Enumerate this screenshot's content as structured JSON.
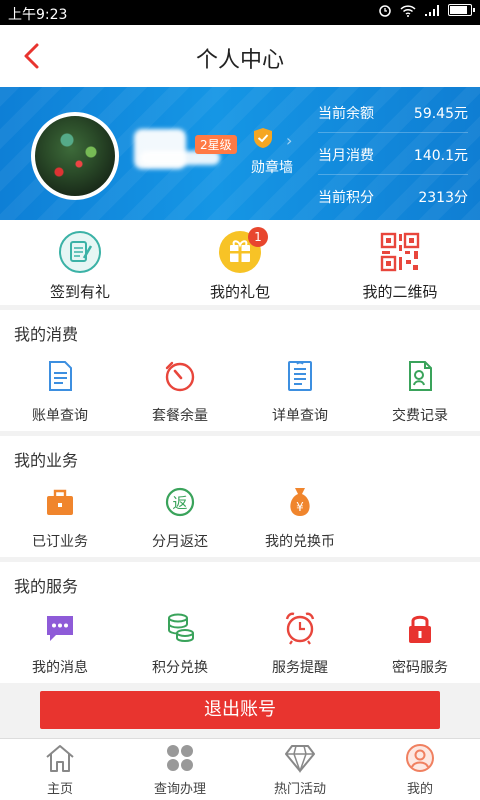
{
  "status_bar": {
    "time": "上午9:23"
  },
  "header": {
    "title": "个人中心"
  },
  "profile": {
    "level": "2星级",
    "medal_wall": "勋章墙",
    "account": [
      {
        "label": "当前余额",
        "value": "59.45元"
      },
      {
        "label": "当月消费",
        "value": "140.1元"
      },
      {
        "label": "当前积分",
        "value": "2313分"
      }
    ]
  },
  "quick_actions": [
    {
      "label": "签到有礼",
      "icon": "sign-in-icon"
    },
    {
      "label": "我的礼包",
      "icon": "gift-pack-icon",
      "badge": "1"
    },
    {
      "label": "我的二维码",
      "icon": "qr-code-icon"
    }
  ],
  "sections": [
    {
      "title": "我的消费",
      "items": [
        {
          "label": "账单查询",
          "icon": "bill-icon"
        },
        {
          "label": "套餐余量",
          "icon": "timer-icon"
        },
        {
          "label": "详单查询",
          "icon": "detail-list-icon"
        },
        {
          "label": "交费记录",
          "icon": "payment-record-icon"
        }
      ]
    },
    {
      "title": "我的业务",
      "items": [
        {
          "label": "已订业务",
          "icon": "briefcase-icon"
        },
        {
          "label": "分月返还",
          "icon": "refund-icon"
        },
        {
          "label": "我的兑换币",
          "icon": "money-bag-icon"
        }
      ]
    },
    {
      "title": "我的服务",
      "items": [
        {
          "label": "我的消息",
          "icon": "message-icon"
        },
        {
          "label": "积分兑换",
          "icon": "coins-icon"
        },
        {
          "label": "服务提醒",
          "icon": "alarm-clock-icon"
        },
        {
          "label": "密码服务",
          "icon": "lock-icon"
        }
      ]
    }
  ],
  "logout_label": "退出账号",
  "tabs": [
    {
      "label": "主页",
      "icon": "home-icon"
    },
    {
      "label": "查询办理",
      "icon": "grid-icon"
    },
    {
      "label": "热门活动",
      "icon": "diamond-icon"
    },
    {
      "label": "我的",
      "icon": "user-icon"
    }
  ],
  "colors": {
    "brand_red": "#e8342f",
    "banner_blue": "#1596e5",
    "level_orange": "#ff7a45"
  }
}
